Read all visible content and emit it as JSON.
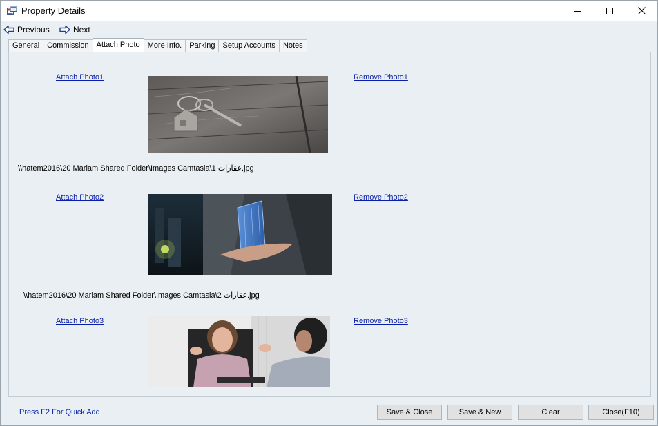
{
  "window": {
    "title": "Property Details"
  },
  "nav": {
    "previous_label": "Previous",
    "next_label": "Next"
  },
  "tabs": [
    {
      "label": "General",
      "active": false
    },
    {
      "label": "Commission",
      "active": false
    },
    {
      "label": "Attach Photo",
      "active": true
    },
    {
      "label": "More Info.",
      "active": false
    },
    {
      "label": "Parking",
      "active": false
    },
    {
      "label": "Setup Accounts",
      "active": false
    },
    {
      "label": "Notes",
      "active": false
    }
  ],
  "photos": [
    {
      "attach_label": "Attach Photo1",
      "remove_label": "Remove Photo1",
      "path": "\\\\hatem2016\\20 Mariam Shared Folder\\Images Camtasia\\1 عقارات.jpg",
      "image": "house-keys-on-wood"
    },
    {
      "attach_label": "Attach Photo2",
      "remove_label": "Remove Photo2",
      "path": "\\\\hatem2016\\20 Mariam Shared Folder\\Images Camtasia\\2 عقارات.jpg",
      "image": "hand-holding-building"
    },
    {
      "attach_label": "Attach Photo3",
      "remove_label": "Remove Photo3",
      "path": "",
      "image": "office-meeting"
    }
  ],
  "footer": {
    "hint": "Press F2 For Quick Add",
    "buttons": {
      "save_close": "Save & Close",
      "save_new": "Save & New",
      "clear": "Clear",
      "close": "Close(F10)"
    }
  },
  "colors": {
    "link": "#0a1fa8",
    "background": "#e9eff2"
  }
}
